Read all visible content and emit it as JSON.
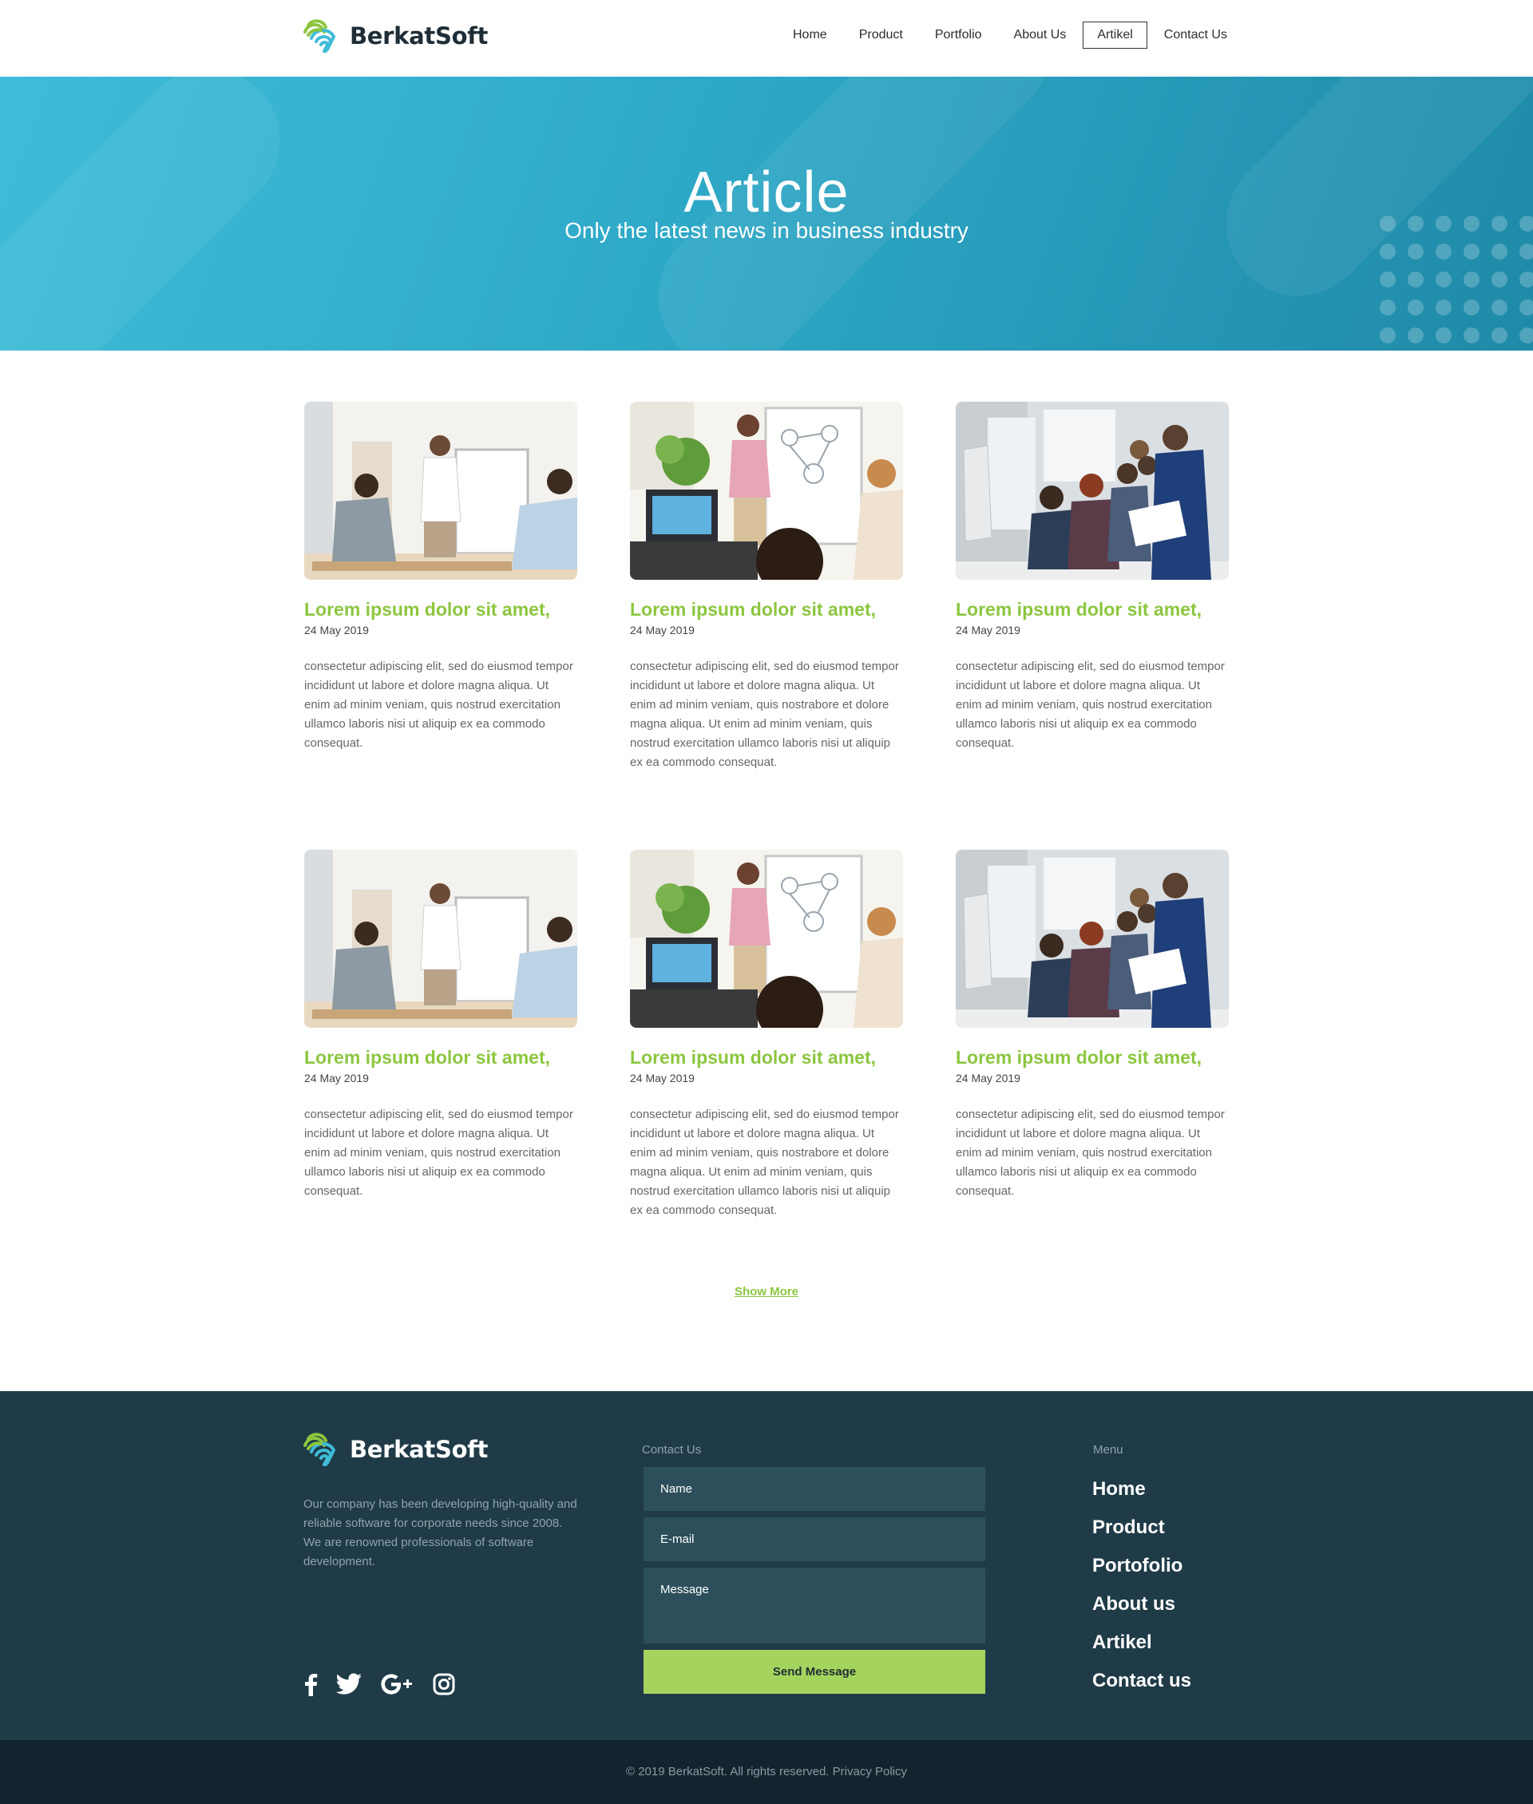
{
  "brand": {
    "name": "BerkatSoft",
    "colors": {
      "primary_green": "#8cc63f",
      "teal": "#2ea8c7",
      "footer_bg": "#1f3b48",
      "bottom_bg": "#12252e",
      "button_green": "#a5d45e"
    }
  },
  "nav": {
    "items": [
      {
        "label": "Home",
        "active": false
      },
      {
        "label": "Product",
        "active": false
      },
      {
        "label": "Portfolio",
        "active": false
      },
      {
        "label": "About Us",
        "active": false
      },
      {
        "label": "Artikel",
        "active": true
      },
      {
        "label": "Contact Us",
        "active": false
      }
    ]
  },
  "hero": {
    "title": "Article",
    "subtitle": "Only the latest news in business industry"
  },
  "articles": [
    {
      "title": "Lorem ipsum dolor sit amet,",
      "date": "24 May 2019",
      "image": "meeting-whiteboard-photo",
      "description": "consectetur adipiscing elit, sed do eiusmod tempor incididunt ut labore et dolore magna aliqua. Ut enim ad minim veniam, quis nostrud exercitation ullamco laboris nisi ut aliquip ex ea commodo consequat."
    },
    {
      "title": "Lorem ipsum dolor sit amet,",
      "date": "24 May 2019",
      "image": "presentation-flipchart-photo",
      "description": "consectetur adipiscing elit, sed do eiusmod tempor incididunt ut labore et dolore magna aliqua. Ut enim ad minim veniam, quis nostrabore et dolore magna aliqua. Ut enim ad minim veniam, quis nostrud exercitation ullamco laboris nisi ut aliquip ex ea commodo consequat."
    },
    {
      "title": "Lorem ipsum dolor sit amet,",
      "date": "24 May 2019",
      "image": "team-laughing-photo",
      "description": "consectetur adipiscing elit, sed do eiusmod tempor incididunt ut labore et dolore magna aliqua. Ut enim ad minim veniam, quis nostrud exercitation ullamco laboris nisi ut aliquip ex ea commodo consequat."
    },
    {
      "title": "Lorem ipsum dolor sit amet,",
      "date": "24 May 2019",
      "image": "meeting-whiteboard-photo",
      "description": "consectetur adipiscing elit, sed do eiusmod tempor incididunt ut labore et dolore magna aliqua. Ut enim ad minim veniam, quis nostrud exercitation ullamco laboris nisi ut aliquip ex ea commodo consequat."
    },
    {
      "title": "Lorem ipsum dolor sit amet,",
      "date": "24 May 2019",
      "image": "presentation-flipchart-photo",
      "description": "consectetur adipiscing elit, sed do eiusmod tempor incididunt ut labore et dolore magna aliqua. Ut enim ad minim veniam, quis nostrabore et dolore magna aliqua. Ut enim ad minim veniam, quis nostrud exercitation ullamco laboris nisi ut aliquip ex ea commodo consequat."
    },
    {
      "title": "Lorem ipsum dolor sit amet,",
      "date": "24 May 2019",
      "image": "team-laughing-photo",
      "description": "consectetur adipiscing elit, sed do eiusmod tempor incididunt ut labore et dolore magna aliqua. Ut enim ad minim veniam, quis nostrud exercitation ullamco laboris nisi ut aliquip ex ea commodo consequat."
    }
  ],
  "show_more": {
    "label": "Show More"
  },
  "footer": {
    "about": "Our company has been developing high-quality and reliable software for corporate needs since 2008. We are renowned professionals of software development.",
    "social": [
      "facebook-icon",
      "twitter-icon",
      "google-plus-icon",
      "instagram-icon"
    ],
    "contact": {
      "heading": "Contact Us",
      "name_placeholder": "Name",
      "email_placeholder": "E-mail",
      "message_placeholder": "Message",
      "send_label": "Send Message"
    },
    "menu": {
      "heading": "Menu",
      "items": [
        "Home",
        "Product",
        "Portofolio",
        "About us",
        "Artikel",
        "Contact us"
      ]
    },
    "copyright": "© 2019 BerkatSoft. All rights reserved.",
    "privacy": "Privacy Policy"
  }
}
